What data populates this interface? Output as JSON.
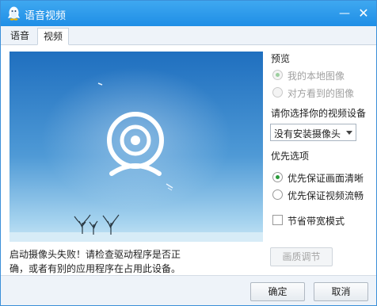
{
  "window": {
    "title": "语音视频"
  },
  "titlebar": {
    "minimize_glyph": "—",
    "close_glyph": "✕"
  },
  "tabs": [
    {
      "label": "语音",
      "selected": false
    },
    {
      "label": "视频",
      "selected": true
    }
  ],
  "preview": {
    "error_message": "启动摄像头失败！请检查驱动程序是否正确，或者有别的应用程序在占用此设备。",
    "error_line1": "启动摄像头失败！请检查驱动程序是否正",
    "error_line2": "确，或者有别的应用程序在占用此设备。"
  },
  "preview_options": {
    "label": "预览",
    "items": [
      {
        "label": "我的本地图像",
        "checked": true,
        "disabled": true
      },
      {
        "label": "对方看到的图像",
        "checked": false,
        "disabled": true
      }
    ]
  },
  "device": {
    "label": "请你选择你的视频设备",
    "selected": "没有安装摄像头"
  },
  "priority": {
    "label": "优先选项",
    "items": [
      {
        "label": "优先保证画面清晰",
        "checked": true
      },
      {
        "label": "优先保证视频流畅",
        "checked": false
      }
    ]
  },
  "bandwidth": {
    "label": "节省带宽模式",
    "checked": false
  },
  "buttons": {
    "quality": "画质调节",
    "ok": "确定",
    "cancel": "取消"
  },
  "colors": {
    "titlebar": "#1f8ee6",
    "accent_green": "#2a9a3a",
    "sky_top": "#1f6fbf",
    "sky_bottom": "#a7d4ef"
  }
}
